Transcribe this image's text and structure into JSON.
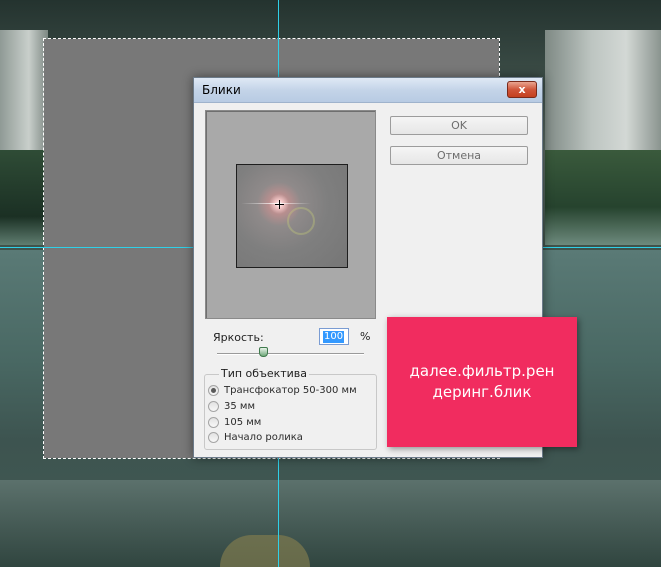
{
  "dialog": {
    "title": "Блики",
    "close_label": "x",
    "ok_label": "OK",
    "cancel_label": "Отмена",
    "brightness_label": "Яркость:",
    "brightness_value": "100",
    "brightness_unit": "%",
    "brightness_level": 1.0,
    "lens_group_title": "Тип объектива",
    "lens_options": [
      {
        "label": "Трансфокатор 50-300 мм",
        "selected": true
      },
      {
        "label": "35 мм",
        "selected": false
      },
      {
        "label": "105 мм",
        "selected": false
      },
      {
        "label": "Начало ролика",
        "selected": false
      }
    ]
  },
  "annotation": {
    "line1": "далее.фильтр.рен",
    "line2": "деринг.блик",
    "color": "#f12c5f"
  },
  "colors": {
    "guide": "#2fd0e8",
    "layer": "#787878"
  }
}
